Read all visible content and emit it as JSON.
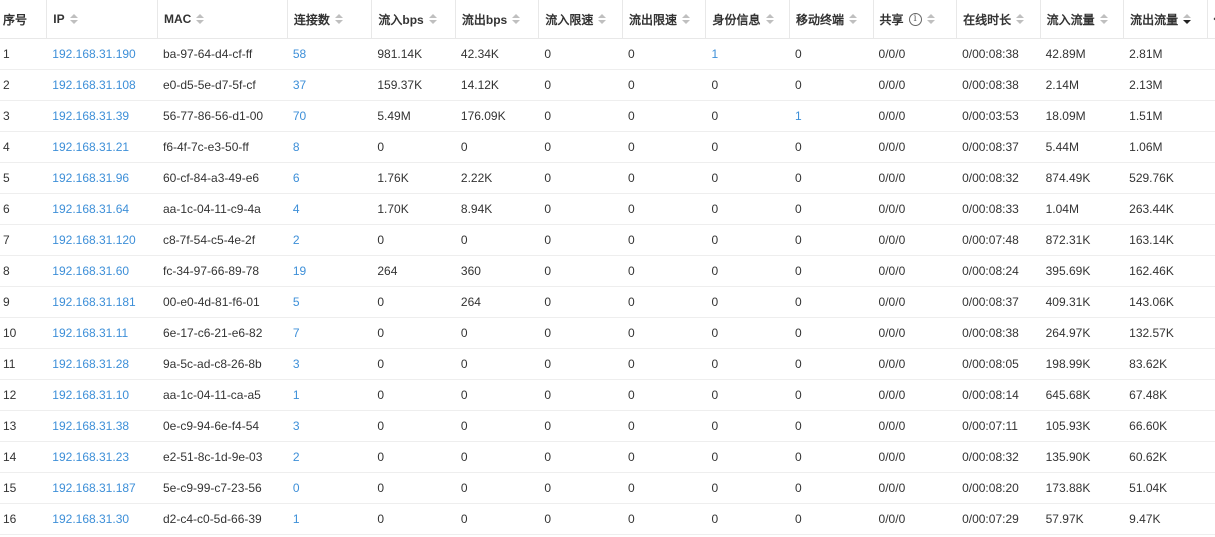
{
  "columns": [
    {
      "key": "no",
      "label": "序号",
      "sortable": false
    },
    {
      "key": "ip",
      "label": "IP",
      "sortable": true
    },
    {
      "key": "mac",
      "label": "MAC",
      "sortable": true
    },
    {
      "key": "conn",
      "label": "连接数",
      "sortable": true
    },
    {
      "key": "in_bps",
      "label": "流入bps",
      "sortable": true
    },
    {
      "key": "out_bps",
      "label": "流出bps",
      "sortable": true
    },
    {
      "key": "in_limit",
      "label": "流入限速",
      "sortable": true
    },
    {
      "key": "out_limit",
      "label": "流出限速",
      "sortable": true
    },
    {
      "key": "identity",
      "label": "身份信息",
      "sortable": true
    },
    {
      "key": "mobile",
      "label": "移动终端",
      "sortable": true
    },
    {
      "key": "share",
      "label": "共享",
      "sortable": true,
      "info": true
    },
    {
      "key": "online",
      "label": "在线时长",
      "sortable": true
    },
    {
      "key": "in_traffic",
      "label": "流入流量",
      "sortable": true
    },
    {
      "key": "out_traffic",
      "label": "流出流量",
      "sortable": true,
      "sorted": "desc"
    },
    {
      "key": "agent",
      "label": "代",
      "sortable": false
    }
  ],
  "rows": [
    {
      "no": "1",
      "ip": "192.168.31.190",
      "mac": "ba-97-64-d4-cf-ff",
      "conn": "58",
      "in_bps": "981.14K",
      "out_bps": "42.34K",
      "in_limit": "0",
      "out_limit": "0",
      "identity": "1",
      "mobile": "0",
      "share": "0/0/0",
      "online": "0/00:08:38",
      "in_traffic": "42.89M",
      "out_traffic": "2.81M",
      "agent": ""
    },
    {
      "no": "2",
      "ip": "192.168.31.108",
      "mac": "e0-d5-5e-d7-5f-cf",
      "conn": "37",
      "in_bps": "159.37K",
      "out_bps": "14.12K",
      "in_limit": "0",
      "out_limit": "0",
      "identity": "0",
      "mobile": "0",
      "share": "0/0/0",
      "online": "0/00:08:38",
      "in_traffic": "2.14M",
      "out_traffic": "2.13M",
      "agent": ""
    },
    {
      "no": "3",
      "ip": "192.168.31.39",
      "mac": "56-77-86-56-d1-00",
      "conn": "70",
      "in_bps": "5.49M",
      "out_bps": "176.09K",
      "in_limit": "0",
      "out_limit": "0",
      "identity": "0",
      "mobile": "1",
      "share": "0/0/0",
      "online": "0/00:03:53",
      "in_traffic": "18.09M",
      "out_traffic": "1.51M",
      "agent": ""
    },
    {
      "no": "4",
      "ip": "192.168.31.21",
      "mac": "f6-4f-7c-e3-50-ff",
      "conn": "8",
      "in_bps": "0",
      "out_bps": "0",
      "in_limit": "0",
      "out_limit": "0",
      "identity": "0",
      "mobile": "0",
      "share": "0/0/0",
      "online": "0/00:08:37",
      "in_traffic": "5.44M",
      "out_traffic": "1.06M",
      "agent": ""
    },
    {
      "no": "5",
      "ip": "192.168.31.96",
      "mac": "60-cf-84-a3-49-e6",
      "conn": "6",
      "in_bps": "1.76K",
      "out_bps": "2.22K",
      "in_limit": "0",
      "out_limit": "0",
      "identity": "0",
      "mobile": "0",
      "share": "0/0/0",
      "online": "0/00:08:32",
      "in_traffic": "874.49K",
      "out_traffic": "529.76K",
      "agent": ""
    },
    {
      "no": "6",
      "ip": "192.168.31.64",
      "mac": "aa-1c-04-11-c9-4a",
      "conn": "4",
      "in_bps": "1.70K",
      "out_bps": "8.94K",
      "in_limit": "0",
      "out_limit": "0",
      "identity": "0",
      "mobile": "0",
      "share": "0/0/0",
      "online": "0/00:08:33",
      "in_traffic": "1.04M",
      "out_traffic": "263.44K",
      "agent": ""
    },
    {
      "no": "7",
      "ip": "192.168.31.120",
      "mac": "c8-7f-54-c5-4e-2f",
      "conn": "2",
      "in_bps": "0",
      "out_bps": "0",
      "in_limit": "0",
      "out_limit": "0",
      "identity": "0",
      "mobile": "0",
      "share": "0/0/0",
      "online": "0/00:07:48",
      "in_traffic": "872.31K",
      "out_traffic": "163.14K",
      "agent": ""
    },
    {
      "no": "8",
      "ip": "192.168.31.60",
      "mac": "fc-34-97-66-89-78",
      "conn": "19",
      "in_bps": "264",
      "out_bps": "360",
      "in_limit": "0",
      "out_limit": "0",
      "identity": "0",
      "mobile": "0",
      "share": "0/0/0",
      "online": "0/00:08:24",
      "in_traffic": "395.69K",
      "out_traffic": "162.46K",
      "agent": ""
    },
    {
      "no": "9",
      "ip": "192.168.31.181",
      "mac": "00-e0-4d-81-f6-01",
      "conn": "5",
      "in_bps": "0",
      "out_bps": "264",
      "in_limit": "0",
      "out_limit": "0",
      "identity": "0",
      "mobile": "0",
      "share": "0/0/0",
      "online": "0/00:08:37",
      "in_traffic": "409.31K",
      "out_traffic": "143.06K",
      "agent": ""
    },
    {
      "no": "10",
      "ip": "192.168.31.11",
      "mac": "6e-17-c6-21-e6-82",
      "conn": "7",
      "in_bps": "0",
      "out_bps": "0",
      "in_limit": "0",
      "out_limit": "0",
      "identity": "0",
      "mobile": "0",
      "share": "0/0/0",
      "online": "0/00:08:38",
      "in_traffic": "264.97K",
      "out_traffic": "132.57K",
      "agent": ""
    },
    {
      "no": "11",
      "ip": "192.168.31.28",
      "mac": "9a-5c-ad-c8-26-8b",
      "conn": "3",
      "in_bps": "0",
      "out_bps": "0",
      "in_limit": "0",
      "out_limit": "0",
      "identity": "0",
      "mobile": "0",
      "share": "0/0/0",
      "online": "0/00:08:05",
      "in_traffic": "198.99K",
      "out_traffic": "83.62K",
      "agent": ""
    },
    {
      "no": "12",
      "ip": "192.168.31.10",
      "mac": "aa-1c-04-11-ca-a5",
      "conn": "1",
      "in_bps": "0",
      "out_bps": "0",
      "in_limit": "0",
      "out_limit": "0",
      "identity": "0",
      "mobile": "0",
      "share": "0/0/0",
      "online": "0/00:08:14",
      "in_traffic": "645.68K",
      "out_traffic": "67.48K",
      "agent": ""
    },
    {
      "no": "13",
      "ip": "192.168.31.38",
      "mac": "0e-c9-94-6e-f4-54",
      "conn": "3",
      "in_bps": "0",
      "out_bps": "0",
      "in_limit": "0",
      "out_limit": "0",
      "identity": "0",
      "mobile": "0",
      "share": "0/0/0",
      "online": "0/00:07:11",
      "in_traffic": "105.93K",
      "out_traffic": "66.60K",
      "agent": ""
    },
    {
      "no": "14",
      "ip": "192.168.31.23",
      "mac": "e2-51-8c-1d-9e-03",
      "conn": "2",
      "in_bps": "0",
      "out_bps": "0",
      "in_limit": "0",
      "out_limit": "0",
      "identity": "0",
      "mobile": "0",
      "share": "0/0/0",
      "online": "0/00:08:32",
      "in_traffic": "135.90K",
      "out_traffic": "60.62K",
      "agent": ""
    },
    {
      "no": "15",
      "ip": "192.168.31.187",
      "mac": "5e-c9-99-c7-23-56",
      "conn": "0",
      "in_bps": "0",
      "out_bps": "0",
      "in_limit": "0",
      "out_limit": "0",
      "identity": "0",
      "mobile": "0",
      "share": "0/0/0",
      "online": "0/00:08:20",
      "in_traffic": "173.88K",
      "out_traffic": "51.04K",
      "agent": ""
    },
    {
      "no": "16",
      "ip": "192.168.31.30",
      "mac": "d2-c4-c0-5d-66-39",
      "conn": "1",
      "in_bps": "0",
      "out_bps": "0",
      "in_limit": "0",
      "out_limit": "0",
      "identity": "0",
      "mobile": "0",
      "share": "0/0/0",
      "online": "0/00:07:29",
      "in_traffic": "57.97K",
      "out_traffic": "9.47K",
      "agent": ""
    }
  ],
  "share_info_glyph": "i",
  "colors": {
    "link": "#3d8fd8",
    "text": "#333333",
    "border": "#e8e8e8"
  }
}
